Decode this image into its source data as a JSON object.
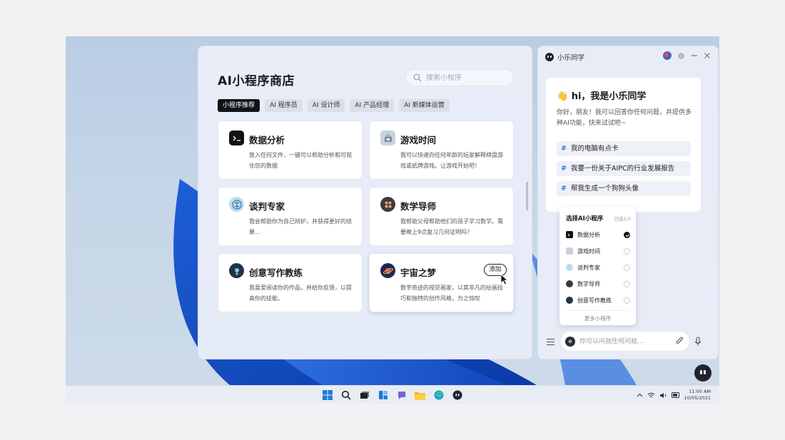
{
  "store": {
    "title": "AI小程序商店",
    "search_placeholder": "搜索小程序",
    "tabs": [
      "小程序推荐",
      "AI 程序员",
      "AI 设计师",
      "AI 产品经理",
      "AI 新媒体运营"
    ],
    "cards": [
      {
        "title": "数据分析",
        "desc": "放入任何文件，一键可以帮助分析和可视化您的数据",
        "icon": "terminal-icon"
      },
      {
        "title": "游戏时间",
        "desc": "我可以快速向任何年龄的玩家解释棋盘游戏或纸牌游戏。让游戏开始吧！",
        "icon": "game-icon"
      },
      {
        "title": "谈判专家",
        "desc": "我会帮助你为自己辩护，并获得更好的结果...",
        "icon": "negotiation-icon"
      },
      {
        "title": "数学导师",
        "desc": "我帮助父母帮助他们的孩子学习数学。需要晚上9点复习几何证明吗？",
        "icon": "math-icon"
      },
      {
        "title": "创意写作教练",
        "desc": "我喜爱阅读你的作品，并给你反馈，以提高你的技能。",
        "icon": "writing-icon"
      },
      {
        "title": "宇宙之梦",
        "desc": "数字奇迹的视觉画家，以其非凡的绘画技巧和独特的创作风格，为之惊叹",
        "icon": "planet-icon"
      }
    ],
    "add_label": "添加"
  },
  "assistant": {
    "name": "小乐同学",
    "greeting": "👋 hi，我是小乐同学",
    "intro": "你好，朋友！我可以回答你任何问题，并提供多种AI功能，快来试试吧~",
    "suggestions": [
      "我的电脑有点卡",
      "我要一份关于AIPC的行业发展报告",
      "帮我生成一个狗狗头像"
    ],
    "popup": {
      "title": "选择AI小程序",
      "count": "已选1/3",
      "items": [
        "数据分析",
        "游戏时间",
        "谈判专家",
        "数学导师",
        "创意写作教练"
      ],
      "selected": 0,
      "more": "更多小程序"
    },
    "input_placeholder": "你可以问我任何问题…"
  },
  "taskbar": {
    "time": "11:00 AM",
    "date": "10/05/2021"
  },
  "colors": {
    "accent": "#3e6ee8",
    "active_tab": "#121316"
  }
}
